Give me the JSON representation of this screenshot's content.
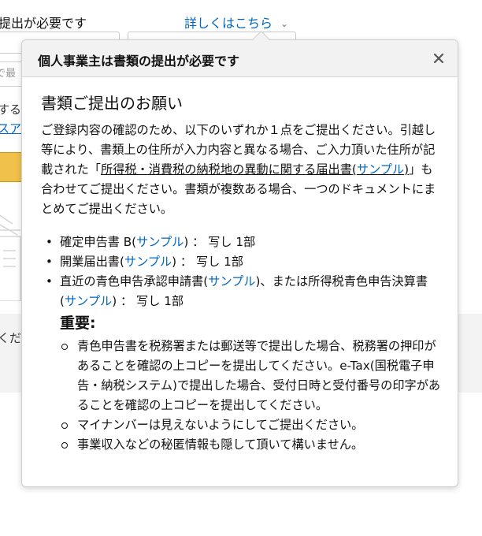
{
  "background": {
    "top_text": "提出が必要です",
    "details_link": "詳しくはこちら",
    "input_hint": "で最",
    "text_fragment_1": "する",
    "link_fragment": "スア",
    "text_fragment_2": "くだ"
  },
  "popover": {
    "title": "個人事業主は書類の提出が必要です",
    "close_icon": "close-icon",
    "heading": "書類ご提出のお願い",
    "intro": {
      "part1": "ご登録内容の確認のため、以下のいずれか１点をご提出ください。引越し等により、書類上の住所が入力内容と異なる場合、ご入力頂いた住所が記載された「",
      "underlined": "所得税・消費税の納税地の異動に関する届出書",
      "open_paren": "(",
      "sample": "サンプル",
      "close_paren": ")",
      "part2": "」も合わせてご提出ください。書類が複数ある場合、一つのドキュメントにまとめてご提出ください。"
    },
    "documents": [
      {
        "name": "確定申告書 B(",
        "sample": "サンプル",
        "suffix": ") ： 写し 1部"
      },
      {
        "name": "開業届出書(",
        "sample": "サンプル",
        "suffix": ") ： 写し 1部"
      },
      {
        "name": "直近の青色申告承認申請書(",
        "sample": "サンプル",
        "mid": ")、または所得税青色申告決算書(",
        "sample2": "サンプル",
        "suffix": ") ： 写し 1部"
      }
    ],
    "important_label": "重要:",
    "notes": [
      "青色申告書を税務署または郵送等で提出した場合、税務署の押印があることを確認の上コピーを提出してください。e-Tax(国税電子申告・納税システム)で提出した場合、受付日時と受付番号の印字があることを確認の上コピーを提出してください。",
      "マイナンバーは見えないようにしてご提出ください。",
      "事業収入などの秘匿情報も隠して頂いて構いません。"
    ]
  }
}
